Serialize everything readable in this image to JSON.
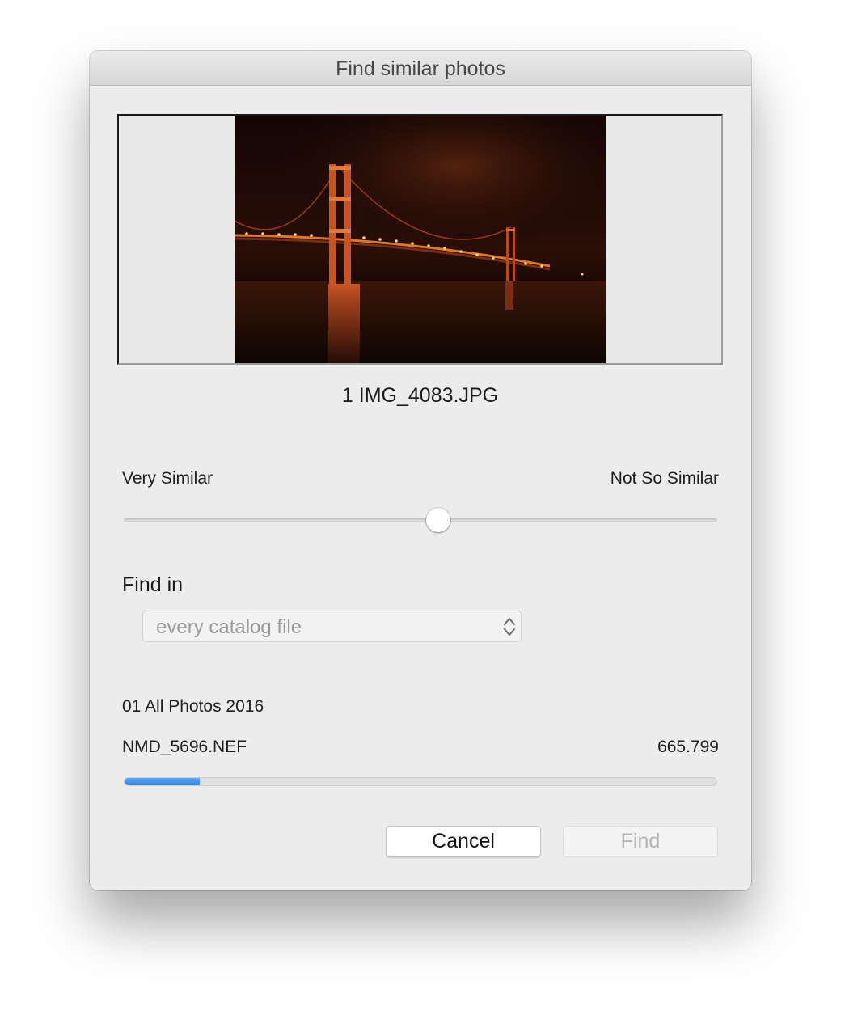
{
  "window": {
    "title": "Find similar photos"
  },
  "preview": {
    "caption": "1 IMG_4083.JPG"
  },
  "similarity": {
    "left_label": "Very Similar",
    "right_label": "Not So Similar",
    "value_fraction": 0.53
  },
  "find_in": {
    "label": "Find in",
    "selected": "every catalog file",
    "arrows_icon": "up-down-chevron-icon"
  },
  "progress": {
    "catalog": "01 All Photos 2016",
    "current_file": "NMD_5696.NEF",
    "count": "665.799",
    "fraction": 0.127,
    "color": "#3b8ded"
  },
  "buttons": {
    "cancel": "Cancel",
    "find": "Find"
  }
}
